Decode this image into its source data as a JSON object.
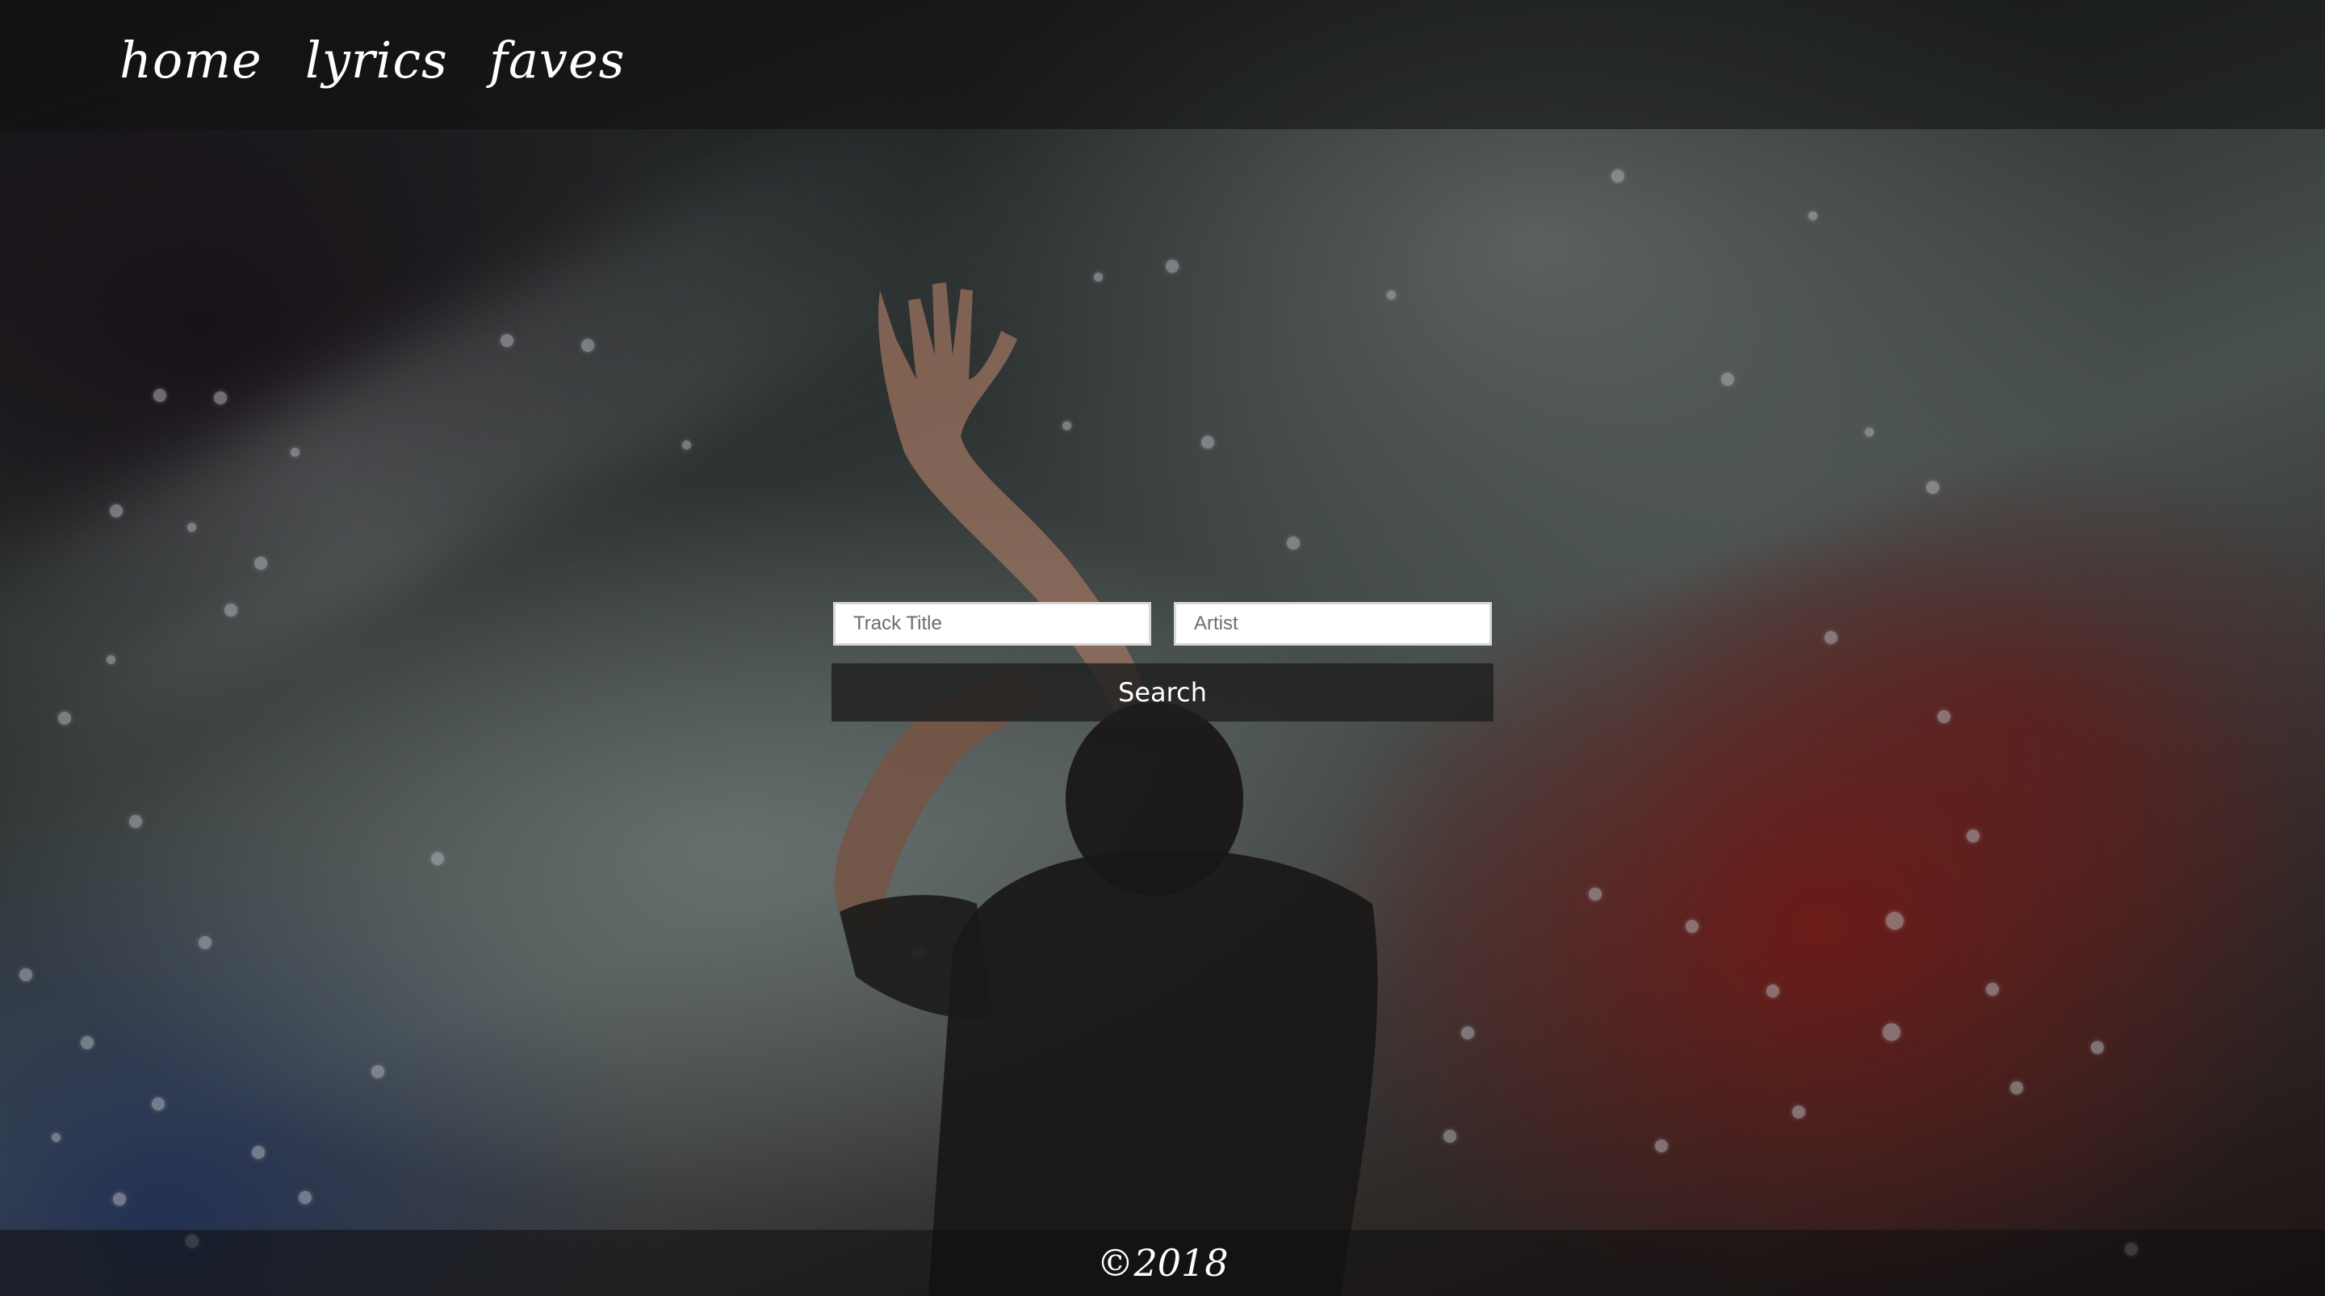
{
  "nav": {
    "home_label": "home",
    "lyrics_label": "lyrics",
    "faves_label": "faves"
  },
  "search": {
    "track_placeholder": "Track Title",
    "artist_placeholder": "Artist",
    "button_label": "Search"
  },
  "footer": {
    "copyright": "©2018"
  },
  "colors": {
    "bar_overlay": "#0f0f0f",
    "button_bg": "#1e1e1e",
    "text": "#ffffff"
  }
}
